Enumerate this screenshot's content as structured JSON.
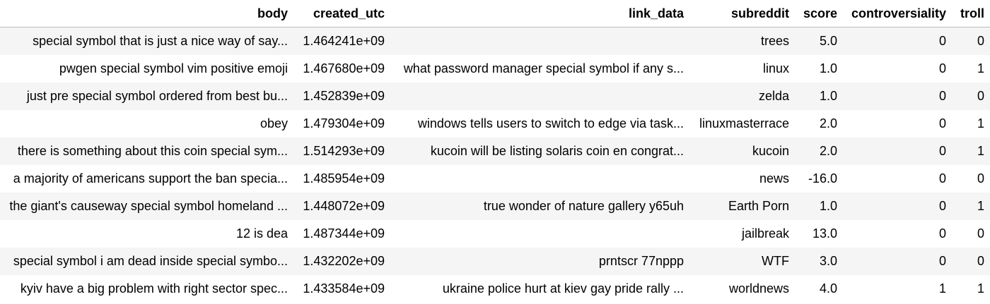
{
  "table": {
    "columns": [
      "body",
      "created_utc",
      "link_data",
      "subreddit",
      "score",
      "controversiality",
      "troll"
    ],
    "rows": [
      [
        "special symbol that is just a nice way of say...",
        "1.464241e+09",
        "",
        "trees",
        "5.0",
        "0",
        "0"
      ],
      [
        "pwgen special symbol vim positive emoji",
        "1.467680e+09",
        "what password manager special symbol if any s...",
        "linux",
        "1.0",
        "0",
        "1"
      ],
      [
        "just pre special symbol ordered from best bu...",
        "1.452839e+09",
        "",
        "zelda",
        "1.0",
        "0",
        "0"
      ],
      [
        "obey",
        "1.479304e+09",
        "windows tells users to switch to edge via task...",
        "linuxmasterrace",
        "2.0",
        "0",
        "1"
      ],
      [
        "there is something about this coin special sym...",
        "1.514293e+09",
        "kucoin will be listing solaris coin en congrat...",
        "kucoin",
        "2.0",
        "0",
        "1"
      ],
      [
        "a majority of americans support the ban specia...",
        "1.485954e+09",
        "",
        "news",
        "-16.0",
        "0",
        "0"
      ],
      [
        "the giant's causeway special symbol homeland ...",
        "1.448072e+09",
        "true wonder of nature gallery y65uh",
        "Earth Porn",
        "1.0",
        "0",
        "1"
      ],
      [
        "12 is dea",
        "1.487344e+09",
        "",
        "jailbreak",
        "13.0",
        "0",
        "0"
      ],
      [
        "special symbol i am dead inside special symbo...",
        "1.432202e+09",
        "prntscr 77nppp",
        "WTF",
        "3.0",
        "0",
        "0"
      ],
      [
        "kyiv have a big problem with right sector spec...",
        "1.433584e+09",
        "ukraine police hurt at kiev gay pride rally ...",
        "worldnews",
        "4.0",
        "1",
        "1"
      ]
    ]
  }
}
